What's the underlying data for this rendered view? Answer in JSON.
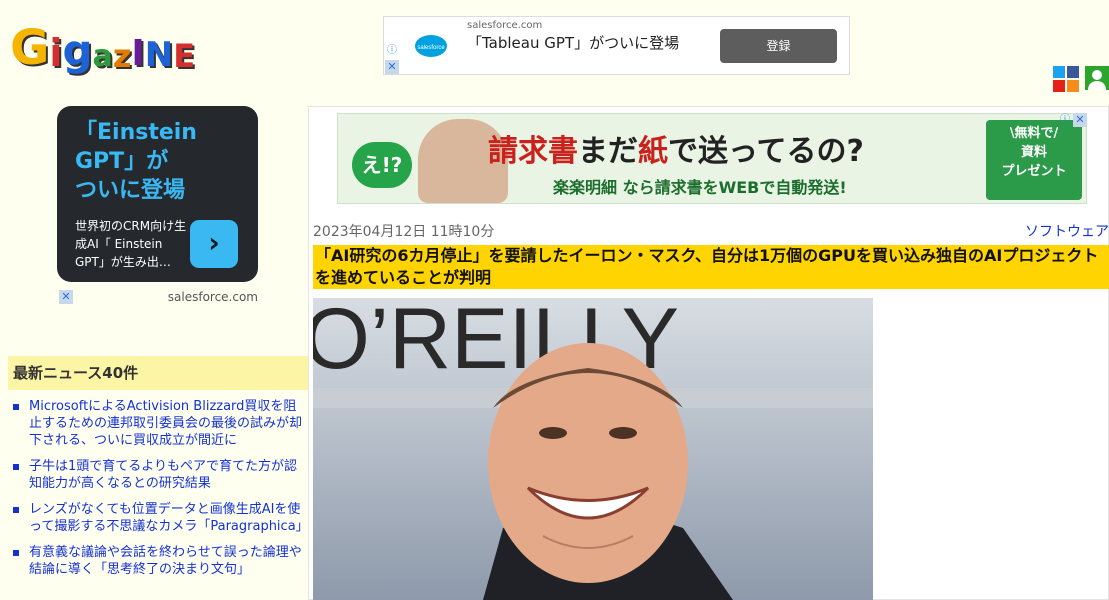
{
  "site": {
    "logo_letters": [
      "G",
      "i",
      "g",
      "a",
      "z",
      "I",
      "N",
      "E"
    ],
    "logo_colors": [
      "#f4b400",
      "#d32f2f",
      "#1e63d6",
      "#2e9a3d",
      "#e37b00",
      "#6a1b9a",
      "#1e63d6",
      "#d32f2f"
    ]
  },
  "top_ad": {
    "domain": "salesforce.com",
    "headline": "「Tableau GPT」がついに登場",
    "button_label": "登録",
    "brand_logo_text": "salesforce"
  },
  "left_ad": {
    "title_lines": [
      "「Einstein",
      "GPT」が",
      "ついに登場"
    ],
    "description": "世界初のCRM向け生成AI「 Einstein GPT」が生み出…",
    "arrow": "›",
    "domain": "salesforce.com"
  },
  "news": {
    "heading": "最新ニュース40件",
    "items": [
      "MicrosoftによるActivision Blizzard買収を阻止するための連邦取引委員会の最後の試みが却下される、ついに買収成立が間近に",
      "子牛は1頭で育てるよりもペアで育てた方が認知能力が高くなるとの研究結果",
      "レンズがなくても位置データと画像生成AIを使って撮影する不思議なカメラ「Paragraphica」",
      "有意義な議論や会話を終わらせて誤った論理や結論に導く「思考終了の決まり文句」"
    ]
  },
  "banner": {
    "badge": "え!?",
    "main_part1": "請求書",
    "main_part2": "まだ",
    "main_part3": "紙",
    "main_part4": "で送ってるの?",
    "sub": "楽楽明細 なら請求書をWEBで自動発送!",
    "free_lines": [
      "\\無料で/",
      "資料",
      "プレゼント"
    ]
  },
  "article": {
    "date": "2023年04月12日 11時10分",
    "category": "ソフトウェア",
    "title": "「AI研究の6カ月停止」を要請したイーロン・マスク、自分は1万個のGPUを買い込み独自のAIプロジェクトを進めていることが判明",
    "photo_sign": "O’REILLY"
  },
  "icons": {
    "adchoice": "ⓘ",
    "close": "✕"
  }
}
